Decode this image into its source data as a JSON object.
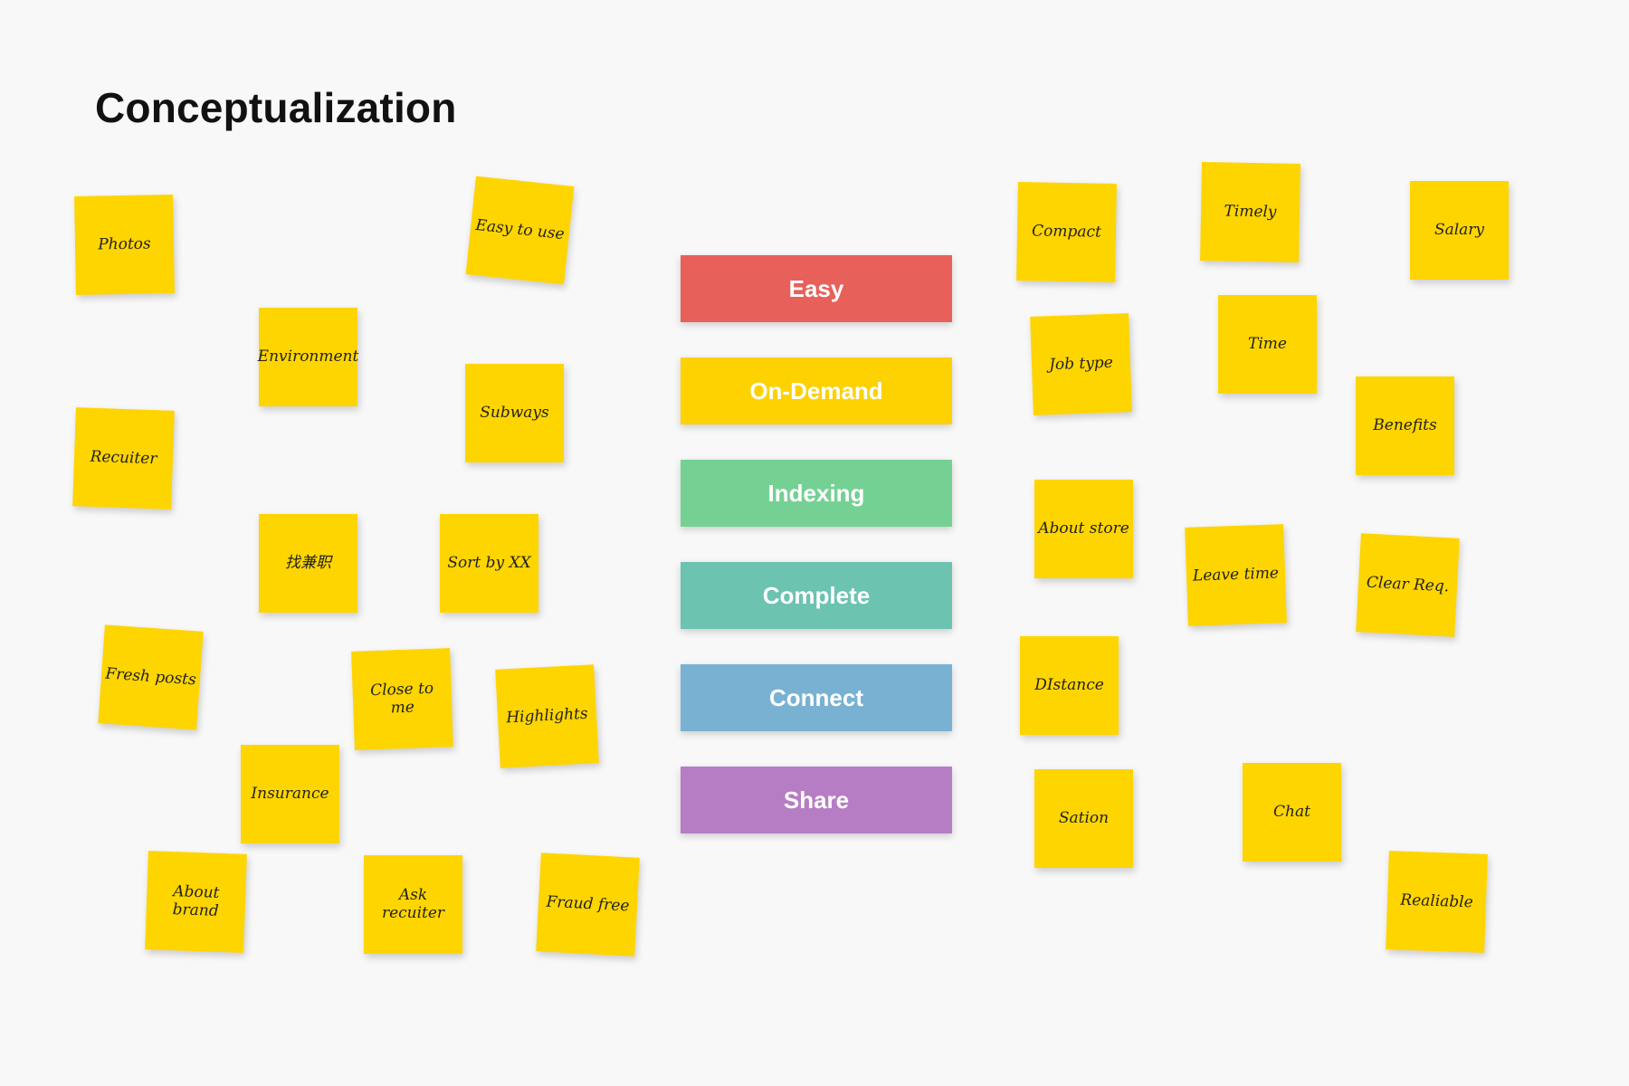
{
  "title": "Conceptualization",
  "categories": [
    {
      "label": "Easy",
      "color": "#e8605a"
    },
    {
      "label": "On-Demand",
      "color": "#fed100"
    },
    {
      "label": "Indexing",
      "color": "#74d193"
    },
    {
      "label": "Complete",
      "color": "#6cc3b0"
    },
    {
      "label": "Connect",
      "color": "#79b1d2"
    },
    {
      "label": "Share",
      "color": "#b77dc4"
    }
  ],
  "sticky_notes": [
    "Photos",
    "Easy to use",
    "Environment",
    "Subways",
    "Recuiter",
    "找兼职",
    "Sort by XX",
    "Fresh posts",
    "Close to me",
    "Highlights",
    "Insurance",
    "About brand",
    "Ask recuiter",
    "Fraud free",
    "Compact",
    "Timely",
    "Salary",
    "Job type",
    "Time",
    "Benefits",
    "About store",
    "Leave time",
    "Clear Req.",
    "DIstance",
    "Sation",
    "Chat",
    "Realiable"
  ],
  "colors": {
    "background": "#f8f8f8",
    "sticky": "#ffd500"
  }
}
